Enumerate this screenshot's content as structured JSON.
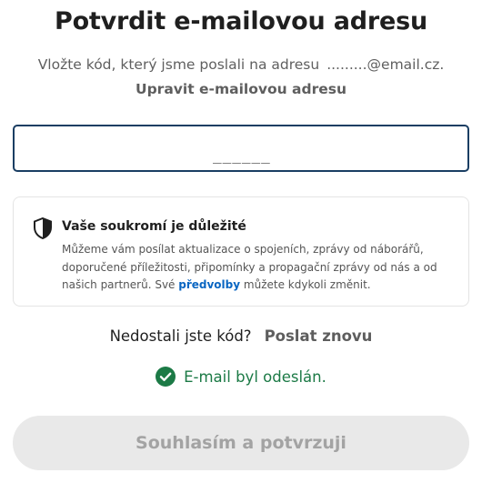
{
  "header": {
    "title": "Potvrdit e-mailovou adresu",
    "subtitle": "Vložte kód, který jsme poslali na adresu",
    "masked_email": ".........@email.cz.",
    "edit_email_link": "Upravit e-mailovou adresu"
  },
  "code_input": {
    "value": "",
    "placeholder_mask": "______"
  },
  "privacy": {
    "icon": "shield-icon",
    "title": "Vaše soukromí je důležité",
    "text_before_link": "Můžeme vám posílat aktualizace o spojeních, zprávy od náborářů, doporučené příležitosti, připomínky a propagační zprávy od nás a od našich partnerů. Své ",
    "link_label": "předvolby",
    "text_after_link": " můžete kdykoli změnit."
  },
  "resend": {
    "question": "Nedostali jste kód?",
    "link_label": "Poslat znovu"
  },
  "status": {
    "icon": "check-circle-icon",
    "message": "E-mail byl odeslán.",
    "color": "#1c7a46"
  },
  "submit": {
    "label": "Souhlasím a potvrzuji",
    "disabled": true
  },
  "colors": {
    "input_border": "#1a3e63",
    "link_blue": "#0a66c2",
    "success_green": "#1c7a46",
    "button_disabled_bg": "#e9e9e9"
  }
}
